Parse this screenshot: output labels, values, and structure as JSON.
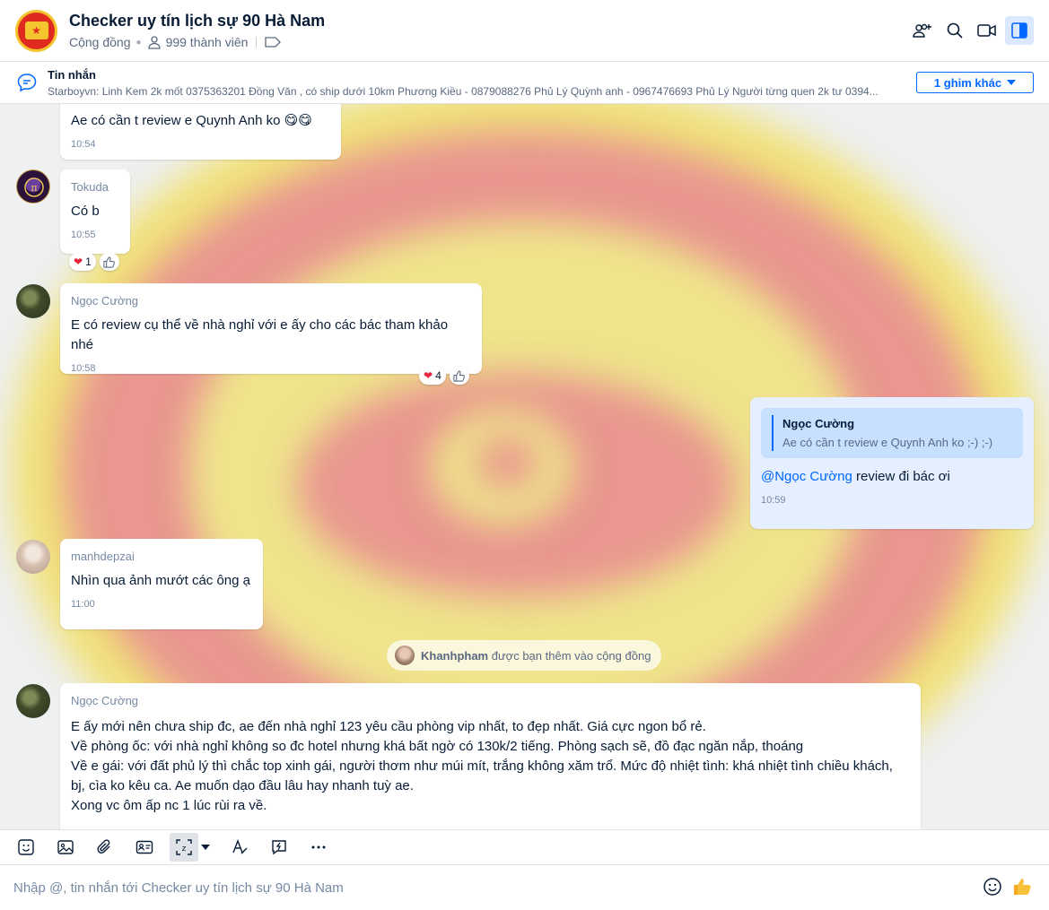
{
  "header": {
    "title": "Checker uy tín lịch sự 90 Hà Nam",
    "type": "Cộng đồng",
    "members": "999 thành viên"
  },
  "pinned": {
    "title": "Tin nhắn",
    "text": "Starboyvn: Linh Kem 2k mốt 0375363201 Đồng Văn , có ship dưới 10km Phương Kiều - 0879088276 Phủ Lý Quỳnh anh - 0967476693 Phủ Lý Người từng quen 2k tư 0394...",
    "button": "1 ghim khác"
  },
  "messages": [
    {
      "text": "Ae có cần t review e Quynh Anh ko 😋😋",
      "time": "10:54"
    },
    {
      "sender": "Tokuda",
      "text": "Có b",
      "time": "10:55",
      "heart_count": "1"
    },
    {
      "sender": "Ngọc Cường",
      "text": "E có review cụ thể về nhà nghỉ với e ấy cho các bác tham khảo nhé",
      "time": "10:58",
      "heart_count": "4"
    },
    {
      "quote_name": "Ngọc Cường",
      "quote_text": "Ae có cần t review e Quynh Anh ko ;-) ;-)",
      "mention": "@Ngọc Cường",
      "text": " review đi bác ơi",
      "time": "10:59"
    },
    {
      "sender": "manhdepzai",
      "text": "Nhìn qua ảnh mướt các ông ạ",
      "time": "11:00"
    },
    {
      "sender": "Ngọc Cường",
      "lines": [
        "E ấy mới nên chưa ship đc, ae đến nhà nghỉ 123 yêu cầu phòng vip nhất, to đẹp nhất. Giá cực ngon bổ rẻ.",
        "Về phòng ốc: với nhà nghỉ không so đc hotel nhưng khá bất ngờ có 130k/2 tiếng. Phòng sạch sẽ, đồ đạc ngăn nắp, thoáng",
        "Về e gái: với đất phủ lý thì chắc top xinh gái, người thơm như múi mít, trắng không xăm trổ. Mức độ nhiệt tình: khá nhiệt tình chiều khách,",
        "bj, cìa ko kêu ca. Ae muốn dạo đầu lâu hay nhanh tuỳ ae.",
        "Xong vc ôm ấp nc 1 lúc rùi ra về."
      ]
    }
  ],
  "system": {
    "name": "Khanhpham",
    "text": "được bạn thêm vào cộng đồng"
  },
  "composer": {
    "placeholder": "Nhập @, tin nhắn tới Checker uy tín lịch sự 90 Hà Nam"
  },
  "colors": {
    "accent": "#0068ff",
    "emblem_red": "#e02a1f",
    "emblem_yellow": "#f5e66a"
  }
}
